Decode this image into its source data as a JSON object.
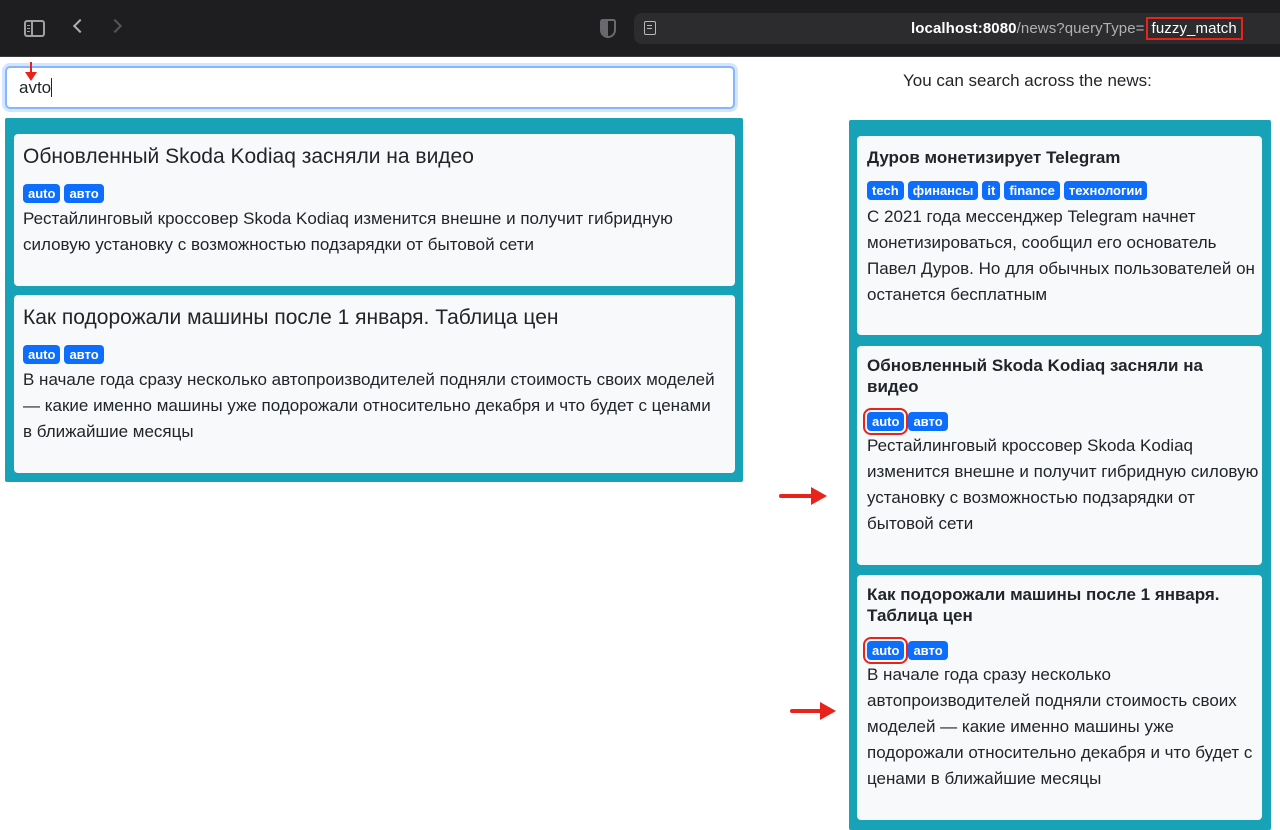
{
  "browser": {
    "url_host": "localhost:8080",
    "url_path": "/news?queryType=",
    "url_highlight": "fuzzy_match"
  },
  "search": {
    "value": "avto"
  },
  "hint": "You can search across the news:",
  "results": [
    {
      "title": "Обновленный Skoda Kodiaq засняли на видео",
      "tags": [
        "auto",
        "авто"
      ],
      "body": "Рестайлинговый кроссовер Skoda Kodiaq изменится внешне и получит гибридную силовую установку с возможностью подзарядки от бытовой сети"
    },
    {
      "title": "Как подорожали машины после 1 января. Таблица цен",
      "tags": [
        "auto",
        "авто"
      ],
      "body": "В начале года сразу несколько автопроизводителей подняли стоимость своих моделей — какие именно машины уже подорожали относительно декабря и что будет с ценами в ближайшие месяцы"
    }
  ],
  "all_news": [
    {
      "title": "Дуров монетизирует Telegram",
      "tags": [
        "tech",
        "финансы",
        "it",
        "finance",
        "технологии"
      ],
      "body": "С 2021 года мессенджер Telegram начнет монетизироваться, сообщил его основатель Павел Дуров. Но для обычных пользователей он останется бесплатным"
    },
    {
      "title": "Обновленный Skoda Kodiaq засняли на видео",
      "tags": [
        "auto",
        "авто"
      ],
      "body": "Рестайлинговый кроссовер Skoda Kodiaq изменится внешне и получит гибридную силовую установку с возможностью подзарядки от бытовой сети"
    },
    {
      "title": "Как подорожали машины после 1 января. Таблица цен",
      "tags": [
        "auto",
        "авто"
      ],
      "body": "В начале года сразу несколько автопроизводителей подняли стоимость своих моделей — какие именно машины уже подорожали относительно декабря и что будет с ценами в ближайшие месяцы"
    }
  ],
  "colors": {
    "panel": "#17a2b8",
    "card": "#f8f9fa",
    "tag": "#0d6efd",
    "annotation": "#e8231b"
  }
}
